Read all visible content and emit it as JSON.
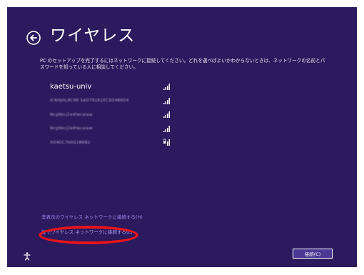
{
  "page": {
    "title": "ワイヤレス",
    "description": "PC のセットアップを完了するにはネットワークに接続してください。どれを選べばよいかわからないときは、ネットワークの名前とパスワードを知っている人に相談してください。"
  },
  "networks": [
    {
      "name": "kaetsu-univ",
      "icon": "wifi-signal-icon",
      "blurred": false
    },
    {
      "name": "ICNHJHL8C9R SAD701R1ECSD4B6D4",
      "icon": "wifi-signal-icon",
      "blurred": true
    },
    {
      "name": "Ncg9bcj2a4fwcaiaw",
      "icon": "wifi-signal-icon",
      "blurred": true
    },
    {
      "name": "Ncg9bcj2a4fwcaiaw",
      "icon": "wifi-signal-icon",
      "blurred": true
    },
    {
      "name": "XD4DC7b0G1B6B2",
      "icon": "wifi-secured-signal-icon",
      "blurred": true
    }
  ],
  "links": {
    "hidden_network": "非表示のワイヤレス ネットワークに接続する(H)",
    "manual_connect": "後でワイヤレス ネットワークに接続する(L)"
  },
  "buttons": {
    "connect": "接続(C)"
  },
  "colors": {
    "background": "#2b1a5d",
    "link": "#9b8cf0",
    "highlight": "#e8141c",
    "button": "#4a3893"
  }
}
